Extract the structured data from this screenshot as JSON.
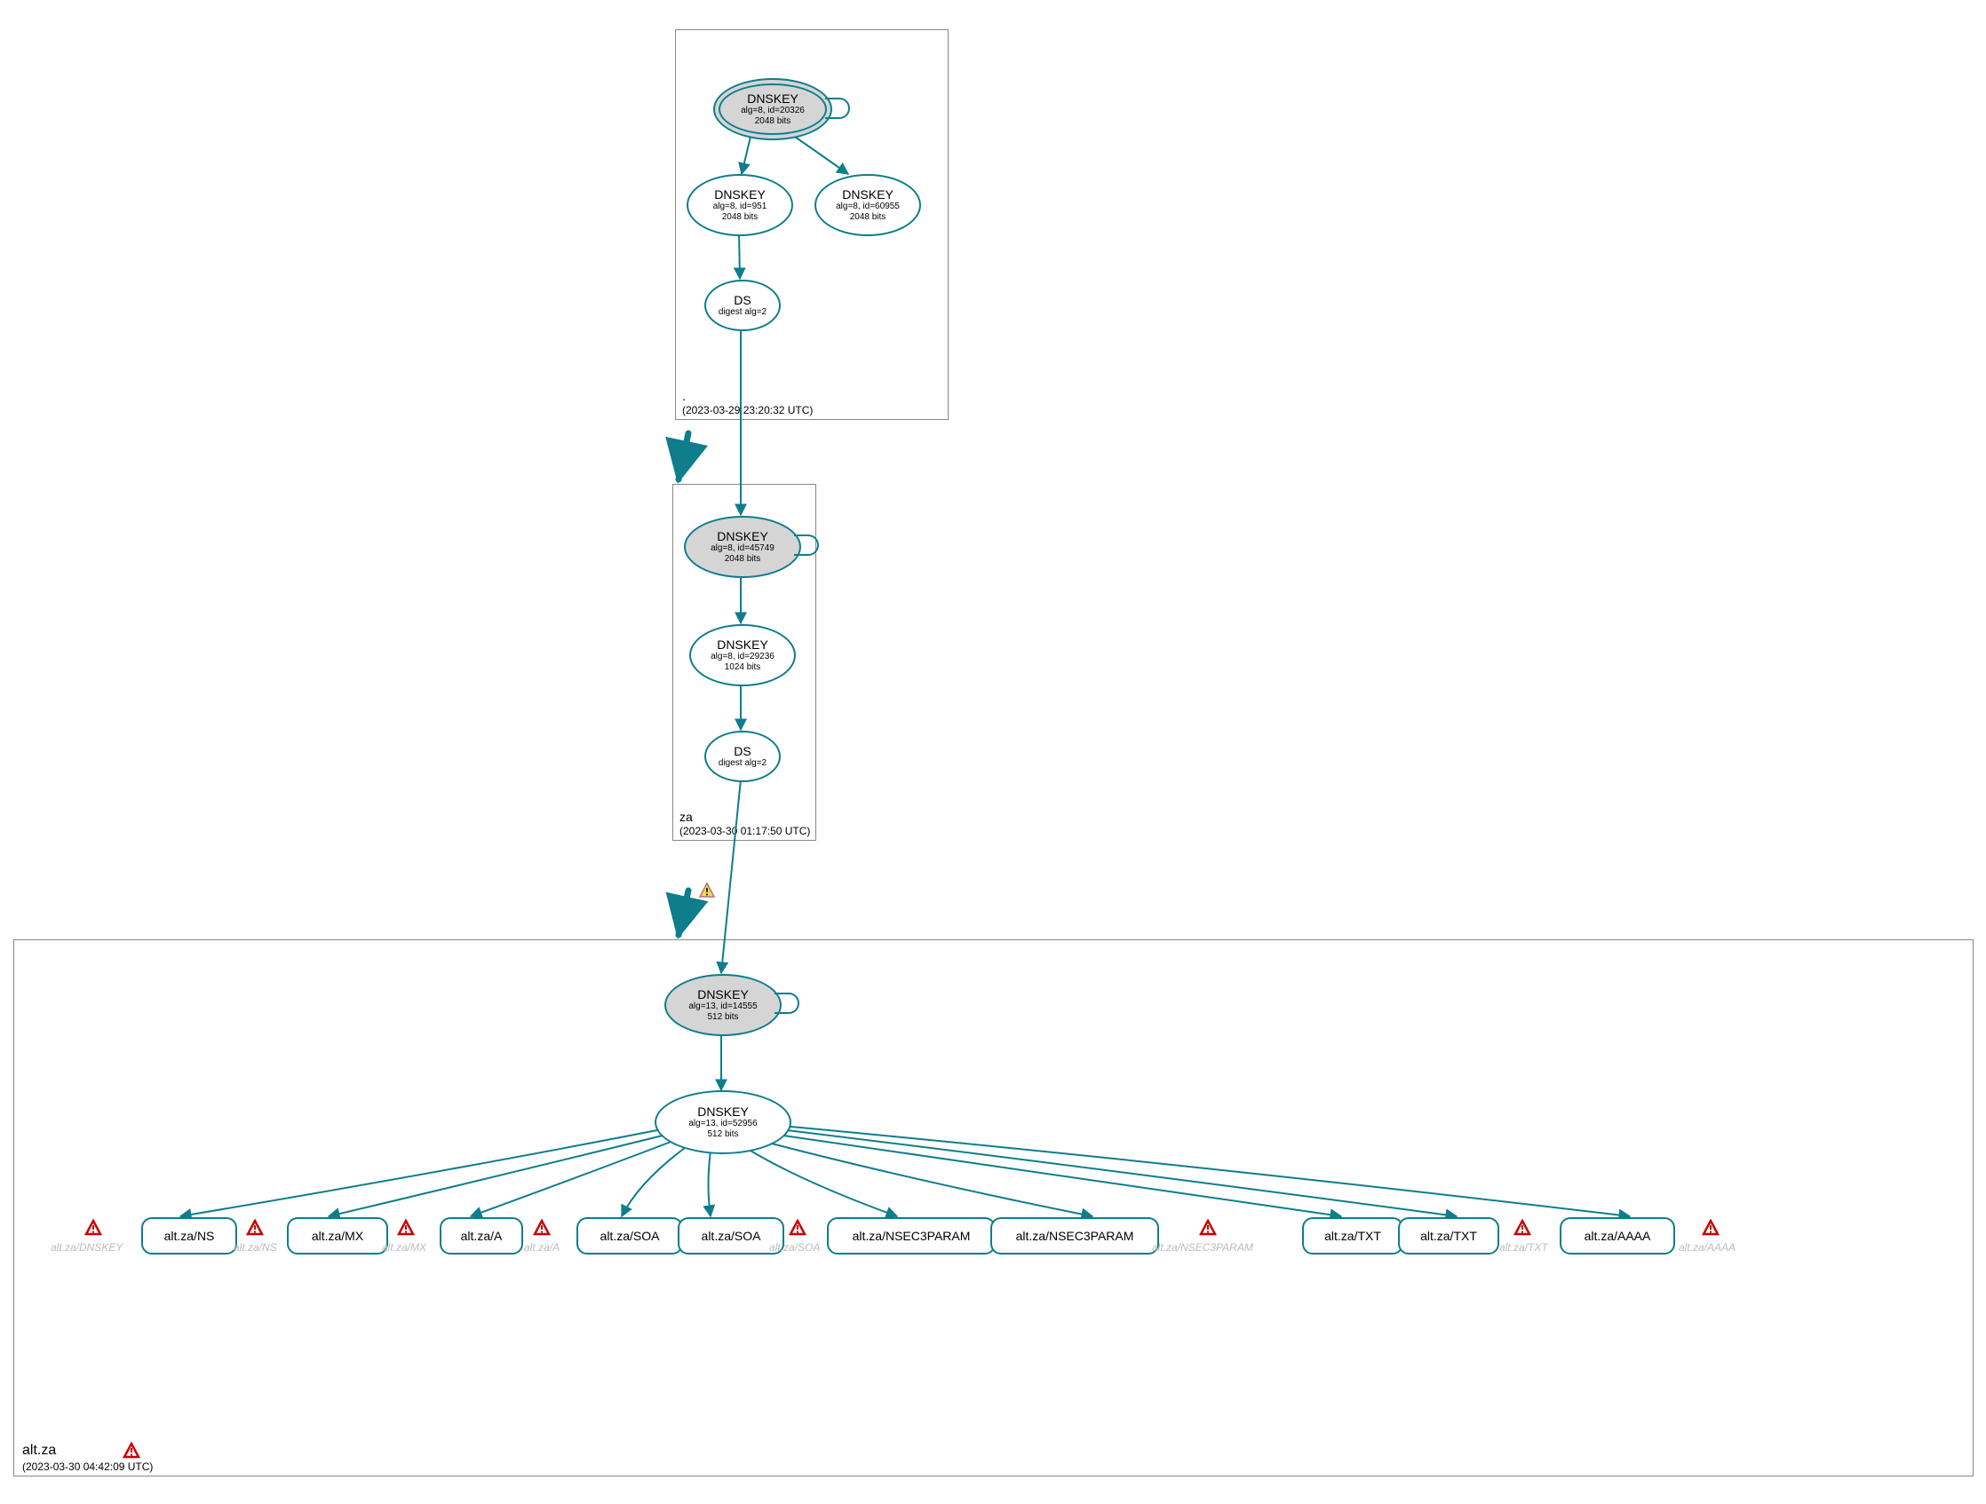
{
  "zones": {
    "root": {
      "name": ".",
      "timestamp": "(2023-03-29 23:20:32 UTC)"
    },
    "za": {
      "name": "za",
      "timestamp": "(2023-03-30 01:17:50 UTC)"
    },
    "altza": {
      "name": "alt.za",
      "timestamp": "(2023-03-30 04:42:09 UTC)"
    }
  },
  "nodes": {
    "root_ksk": {
      "title": "DNSKEY",
      "sub1": "alg=8, id=20326",
      "sub2": "2048 bits"
    },
    "root_zsk": {
      "title": "DNSKEY",
      "sub1": "alg=8, id=951",
      "sub2": "2048 bits"
    },
    "root_zsk2": {
      "title": "DNSKEY",
      "sub1": "alg=8, id=60955",
      "sub2": "2048 bits"
    },
    "root_ds": {
      "title": "DS",
      "sub1": "digest alg=2",
      "sub2": ""
    },
    "za_ksk": {
      "title": "DNSKEY",
      "sub1": "alg=8, id=45749",
      "sub2": "2048 bits"
    },
    "za_zsk": {
      "title": "DNSKEY",
      "sub1": "alg=8, id=29236",
      "sub2": "1024 bits"
    },
    "za_ds": {
      "title": "DS",
      "sub1": "digest alg=2",
      "sub2": ""
    },
    "altza_ksk": {
      "title": "DNSKEY",
      "sub1": "alg=13, id=14555",
      "sub2": "512 bits"
    },
    "altza_zsk": {
      "title": "DNSKEY",
      "sub1": "alg=13, id=52956",
      "sub2": "512 bits"
    }
  },
  "rrsets": {
    "ns": "alt.za/NS",
    "mx": "alt.za/MX",
    "a": "alt.za/A",
    "soa1": "alt.za/SOA",
    "soa2": "alt.za/SOA",
    "n3p1": "alt.za/NSEC3PARAM",
    "n3p2": "alt.za/NSEC3PARAM",
    "txt1": "alt.za/TXT",
    "txt2": "alt.za/TXT",
    "aaaa": "alt.za/AAAA"
  },
  "ghosts": {
    "dnskey": "alt.za/DNSKEY",
    "ns": "alt.za/NS",
    "mx": "alt.za/MX",
    "a": "alt.za/A",
    "soa": "alt.za/SOA",
    "n3p": "alt.za/NSEC3PARAM",
    "txt": "alt.za/TXT",
    "aaaa": "alt.za/AAAA"
  }
}
